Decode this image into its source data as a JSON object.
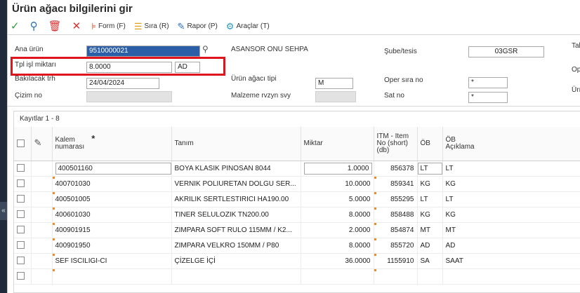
{
  "title": "Ürün ağacı bilgilerini gir",
  "toolbar": {
    "form_label": "Form (F)",
    "sira_label": "Sıra (R)",
    "rapor_label": "Rapor (P)",
    "araclar_label": "Araçlar (T)"
  },
  "form": {
    "ana_urun_label": "Ana ürün",
    "ana_urun_value": "9510000021",
    "ana_urun_desc": "ASANSOR ONU SEHPA",
    "sube_label": "Şube/tesis",
    "sube_value": "03GSR",
    "tal_label": "Tal",
    "tpl_label": "Tpl işl miktarı",
    "tpl_value": "8.0000",
    "tpl_unit": "AD",
    "op_label": "Op",
    "bakilacak_label": "Bakılacak trh",
    "bakilacak_value": "24/04/2024",
    "tip_label": "Ürün ağacı tipi",
    "tip_value": "M",
    "oper_label": "Oper sıra no",
    "oper_value": "*",
    "uri_label": "Ürı",
    "cizim_label": "Çizim no",
    "malzeme_label": "Malzeme rvzyn svy",
    "sat_label": "Sat no",
    "sat_value": "*"
  },
  "grid": {
    "count": "Kayıtlar 1 - 8",
    "headers": {
      "kalem_1": "Kalem",
      "kalem_2": "numarası",
      "star": "*",
      "tanim": "Tanım",
      "miktar": "Miktar",
      "itm_1": "ITM - Item",
      "itm_2": "No (short)",
      "itm_3": "(db)",
      "ob": "ÖB",
      "ob_acik_1": "ÖB",
      "ob_acik_2": "Açıklama"
    },
    "rows": [
      {
        "kalem": "400501160",
        "tanim": "BOYA KLASIK PINOSAN 8044",
        "miktar": "1.0000",
        "itm": "856378",
        "ob": "LT",
        "aciklama": "LT"
      },
      {
        "kalem": "400701030",
        "tanim": "VERNIK POLIURETAN DOLGU SER...",
        "miktar": "10.0000",
        "itm": "859341",
        "ob": "KG",
        "aciklama": "KG"
      },
      {
        "kalem": "400501005",
        "tanim": "AKRILIK SERTLESTIRICI HA190.00",
        "miktar": "5.0000",
        "itm": "855295",
        "ob": "LT",
        "aciklama": "LT"
      },
      {
        "kalem": "400601030",
        "tanim": "TINER SELULOZIK TN200.00",
        "miktar": "8.0000",
        "itm": "858488",
        "ob": "KG",
        "aciklama": "KG"
      },
      {
        "kalem": "400901915",
        "tanim": "ZIMPARA SOFT RULO 115MM / K2...",
        "miktar": "2.0000",
        "itm": "854874",
        "ob": "MT",
        "aciklama": "MT"
      },
      {
        "kalem": "400901950",
        "tanim": "ZIMPARA VELKRO 150MM / P80",
        "miktar": "8.0000",
        "itm": "855720",
        "ob": "AD",
        "aciklama": "AD"
      },
      {
        "kalem": "SEF ISCILIGI-CI",
        "tanim": "ÇİZELGE İÇİ",
        "miktar": "36.0000",
        "itm": "1155910",
        "ob": "SA",
        "aciklama": "SAAT"
      },
      {
        "kalem": "",
        "tanim": "",
        "miktar": "",
        "itm": "",
        "ob": "",
        "aciklama": ""
      }
    ]
  },
  "colors": {
    "highlight": "#e0141e",
    "check": "#2e9e3e",
    "search": "#2a6fc0",
    "delete": "#e03030",
    "accent": "#2a5fa8"
  },
  "icons": [
    "check-icon",
    "search-icon",
    "trash-icon",
    "close-icon",
    "form-icon",
    "sort-icon",
    "report-icon",
    "tools-icon",
    "lookup-arrow-icon",
    "magnifier-icon",
    "grid-settings-icon",
    "collapse-chevron-icon"
  ]
}
